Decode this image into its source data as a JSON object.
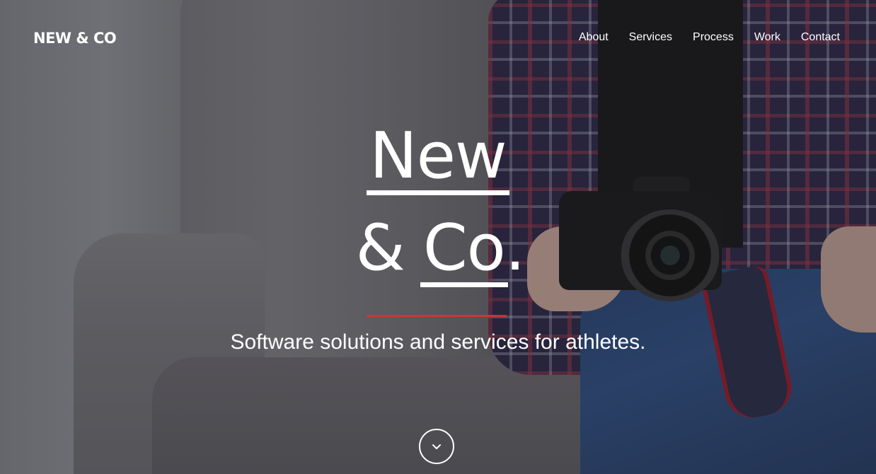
{
  "header": {
    "logo_text": "NEW & CO",
    "nav": [
      {
        "label": "About"
      },
      {
        "label": "Services"
      },
      {
        "label": "Process"
      },
      {
        "label": "Work"
      },
      {
        "label": "Contact"
      }
    ]
  },
  "hero": {
    "title_word1": "New",
    "title_amp": "&",
    "title_word2": "Co",
    "title_period": ".",
    "tagline": "Software solutions and services for athletes.",
    "scroll_icon": "chevron-down-icon"
  },
  "colors": {
    "accent_rule": "#e03030",
    "text": "#ffffff"
  }
}
